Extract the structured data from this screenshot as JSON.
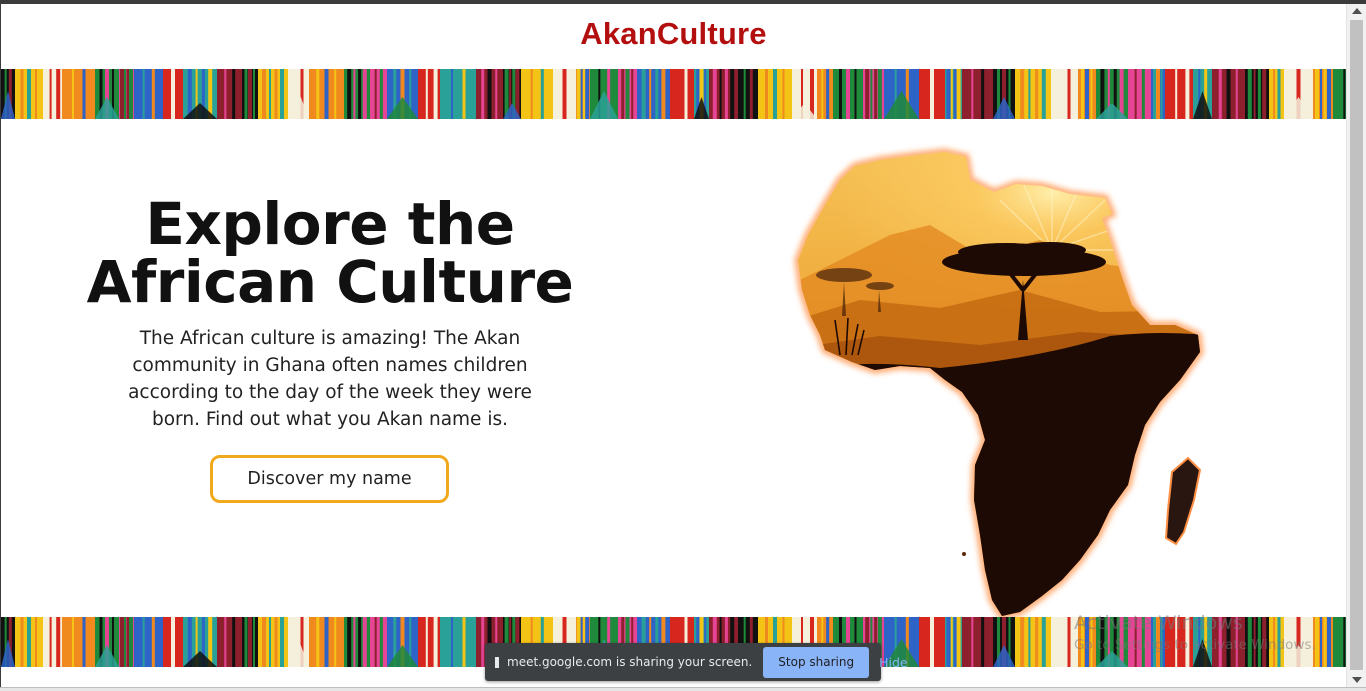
{
  "header": {
    "brand": "AkanCulture"
  },
  "hero": {
    "title_line1": "Explore the",
    "title_line2": "African Culture",
    "description": "The African culture is amazing! The Akan community in Ghana often names children according to the day of the week they were born. Find out what you Akan name is.",
    "cta_label": "Discover my name"
  },
  "colors": {
    "brand": "#b30f0f",
    "cta_border": "#f0a81c",
    "map_silhouette": "#1e0a04",
    "map_sky_top": "#f5b94a",
    "map_sky_bottom": "#d98518",
    "share_bar_bg": "#3c4043",
    "stop_button_bg": "#8ab4f8"
  },
  "images": {
    "kente_banner": "kente-cloth-pattern",
    "africa_map": "africa-map-savanna-sunset"
  },
  "windows_watermark": {
    "title": "Activate Windows",
    "subtitle": "Go to Settings to activate Windows."
  },
  "screen_share": {
    "message": "meet.google.com is sharing your screen.",
    "stop_label": "Stop sharing",
    "hide_label": "Hide"
  }
}
